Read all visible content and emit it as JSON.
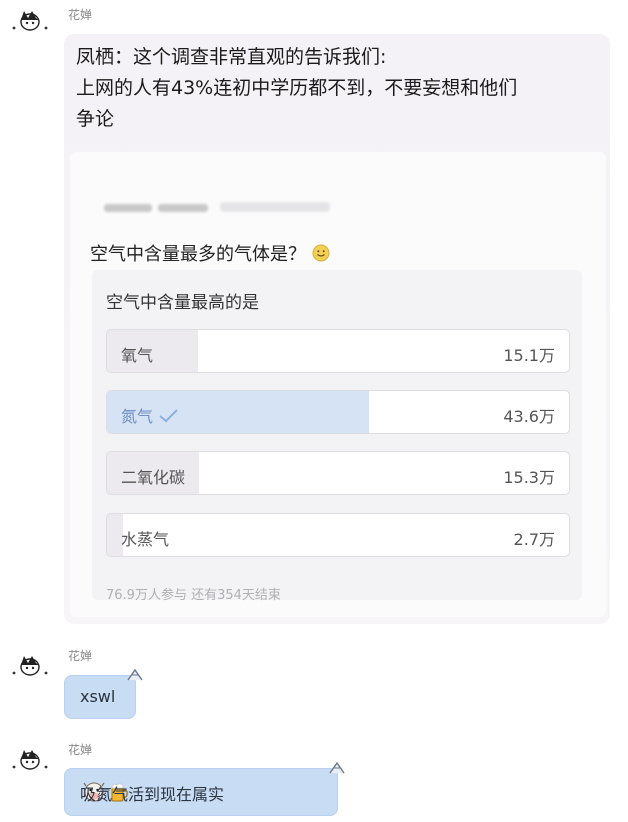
{
  "messages": [
    {
      "sender": "花婵",
      "text_lines": [
        "凤栖：这个调查非常直观的告诉我们:",
        "上网的人有43%连初中学历都不到，不要妄想和他们",
        "争论"
      ],
      "card": {
        "header_blurred": "",
        "question": "空气中含量最多的气体是？",
        "poll": {
          "title": "空气中含量最高的是",
          "options": [
            {
              "label": "氧气",
              "count": "15.1万",
              "fraction": 0.196,
              "selected": false
            },
            {
              "label": "氮气",
              "count": "43.6万",
              "fraction": 0.567,
              "selected": true
            },
            {
              "label": "二氧化碳",
              "count": "15.3万",
              "fraction": 0.199,
              "selected": false
            },
            {
              "label": "水蒸气",
              "count": "2.7万",
              "fraction": 0.035,
              "selected": false
            }
          ],
          "footer": "76.9万人参与  还有354天结束"
        }
      }
    },
    {
      "sender": "花婵",
      "text": "xswl"
    },
    {
      "sender": "花婵",
      "text": "吸氮气活到现在属实"
    }
  ],
  "icons": {
    "avatar": "cartoon-avatar-icon",
    "smile": "smiley-face-icon",
    "check": "checkmark-icon",
    "ribbon": "ribbon-decoration-icon",
    "emoji_1": "cow-face-emoji",
    "emoji_2": "beer-mug-emoji"
  },
  "colors": {
    "bubble": "#c8dcf4",
    "selected_fill": "#d6e3f4",
    "check": "#8fb0dc"
  }
}
